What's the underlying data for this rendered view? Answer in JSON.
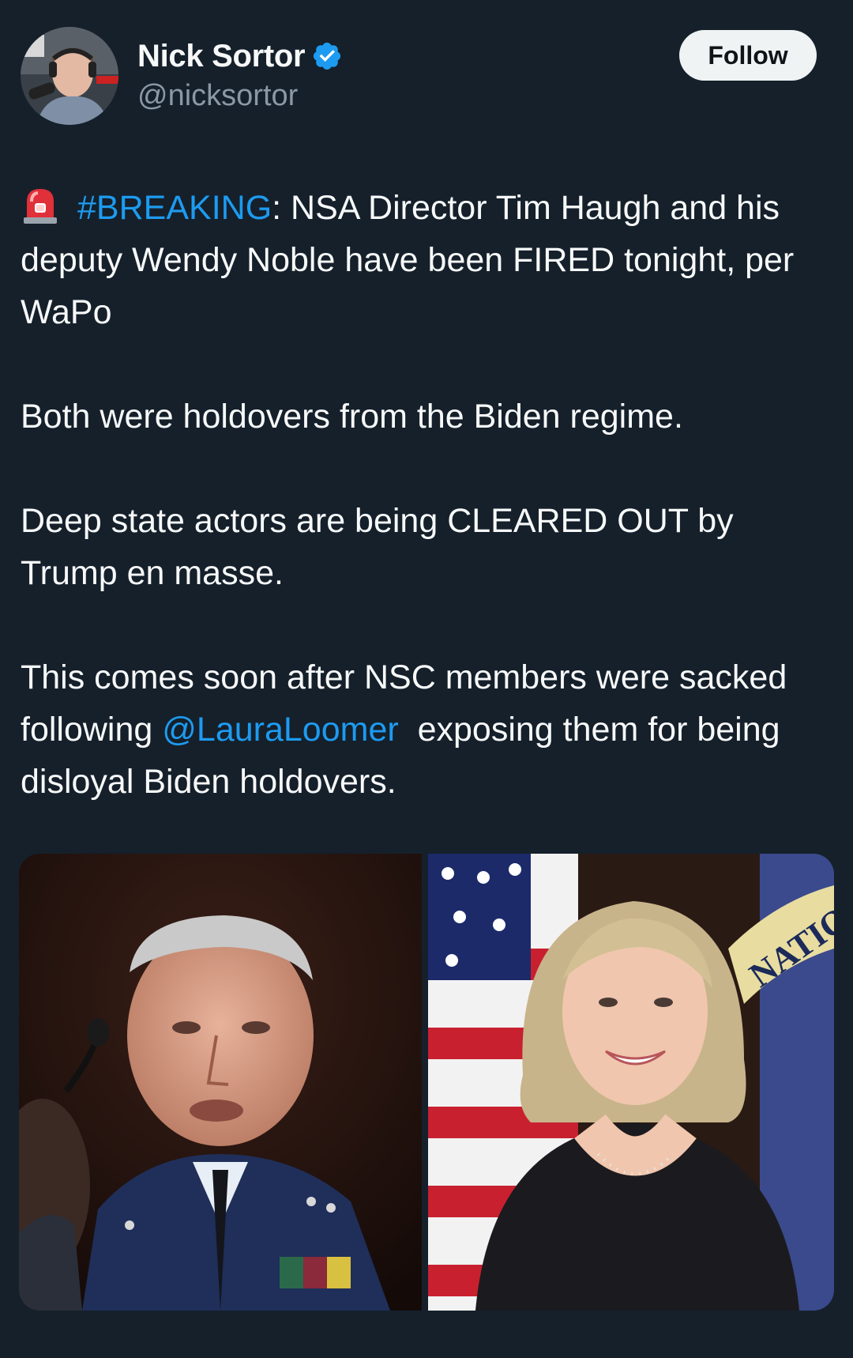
{
  "author": {
    "display_name": "Nick Sortor",
    "handle": "@nicksortor",
    "verified": true,
    "avatar_icon": "profile-photo-avatar",
    "verified_icon": "verified-badge-icon"
  },
  "follow_button": {
    "label": "Follow"
  },
  "tweet": {
    "line1_emoji_icon": "police-siren-emoji",
    "hashtag": "#BREAKING",
    "line1_rest": ": NSA Director Tim Haugh and his deputy Wendy Noble have been FIRED tonight, per WaPo",
    "para2": "Both were holdovers from the Biden regime.",
    "para3": "Deep state actors are being CLEARED OUT by Trump en masse.",
    "para4_before": "This comes soon after NSC members were sacked following ",
    "mention": "@LauraLoomer",
    "para4_after": "  exposing them for being disloyal Biden holdovers."
  },
  "media": {
    "left_image_icon": "photo-man-in-air-force-uniform",
    "right_image_icon": "photo-woman-with-flags",
    "flag_text": "NATIO"
  },
  "colors": {
    "background": "#15202b",
    "text": "#f7f9f9",
    "secondary_text": "#8b98a5",
    "link": "#1d9bf0",
    "button_bg": "#eff3f4",
    "verified": "#1d9bf0"
  }
}
